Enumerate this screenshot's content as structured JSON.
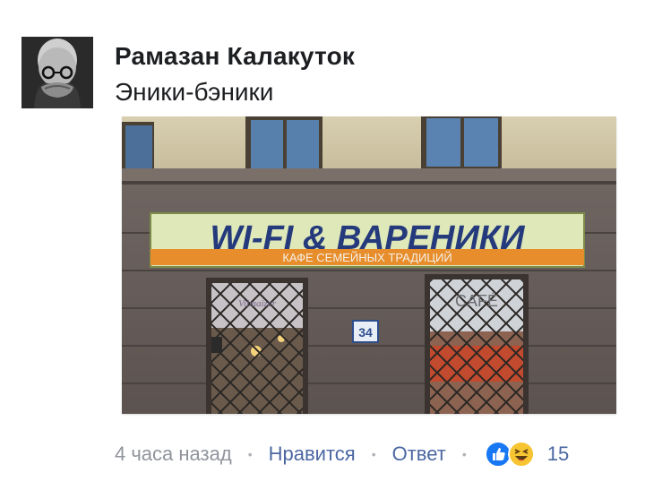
{
  "comment": {
    "author": "Рамазан Калакуток",
    "text": "Эники-бэники",
    "photo": {
      "sign_title": "WI-FI & ВАРЕНИКИ",
      "sign_subtitle": "КАФЕ СЕМЕЙНЫХ ТРАДИЦИЙ",
      "window_label": "CAFÉ",
      "house_number": "34"
    },
    "footer": {
      "timestamp": "4 часа назад",
      "like_label": "Нравится",
      "reply_label": "Ответ",
      "reaction_icons": [
        "like-icon",
        "haha-icon"
      ],
      "reaction_count": "15"
    }
  },
  "colors": {
    "link": "#4b67a1",
    "meta": "#90949c",
    "like_blue": "#1877f2",
    "haha_yellow": "#f7c531"
  }
}
